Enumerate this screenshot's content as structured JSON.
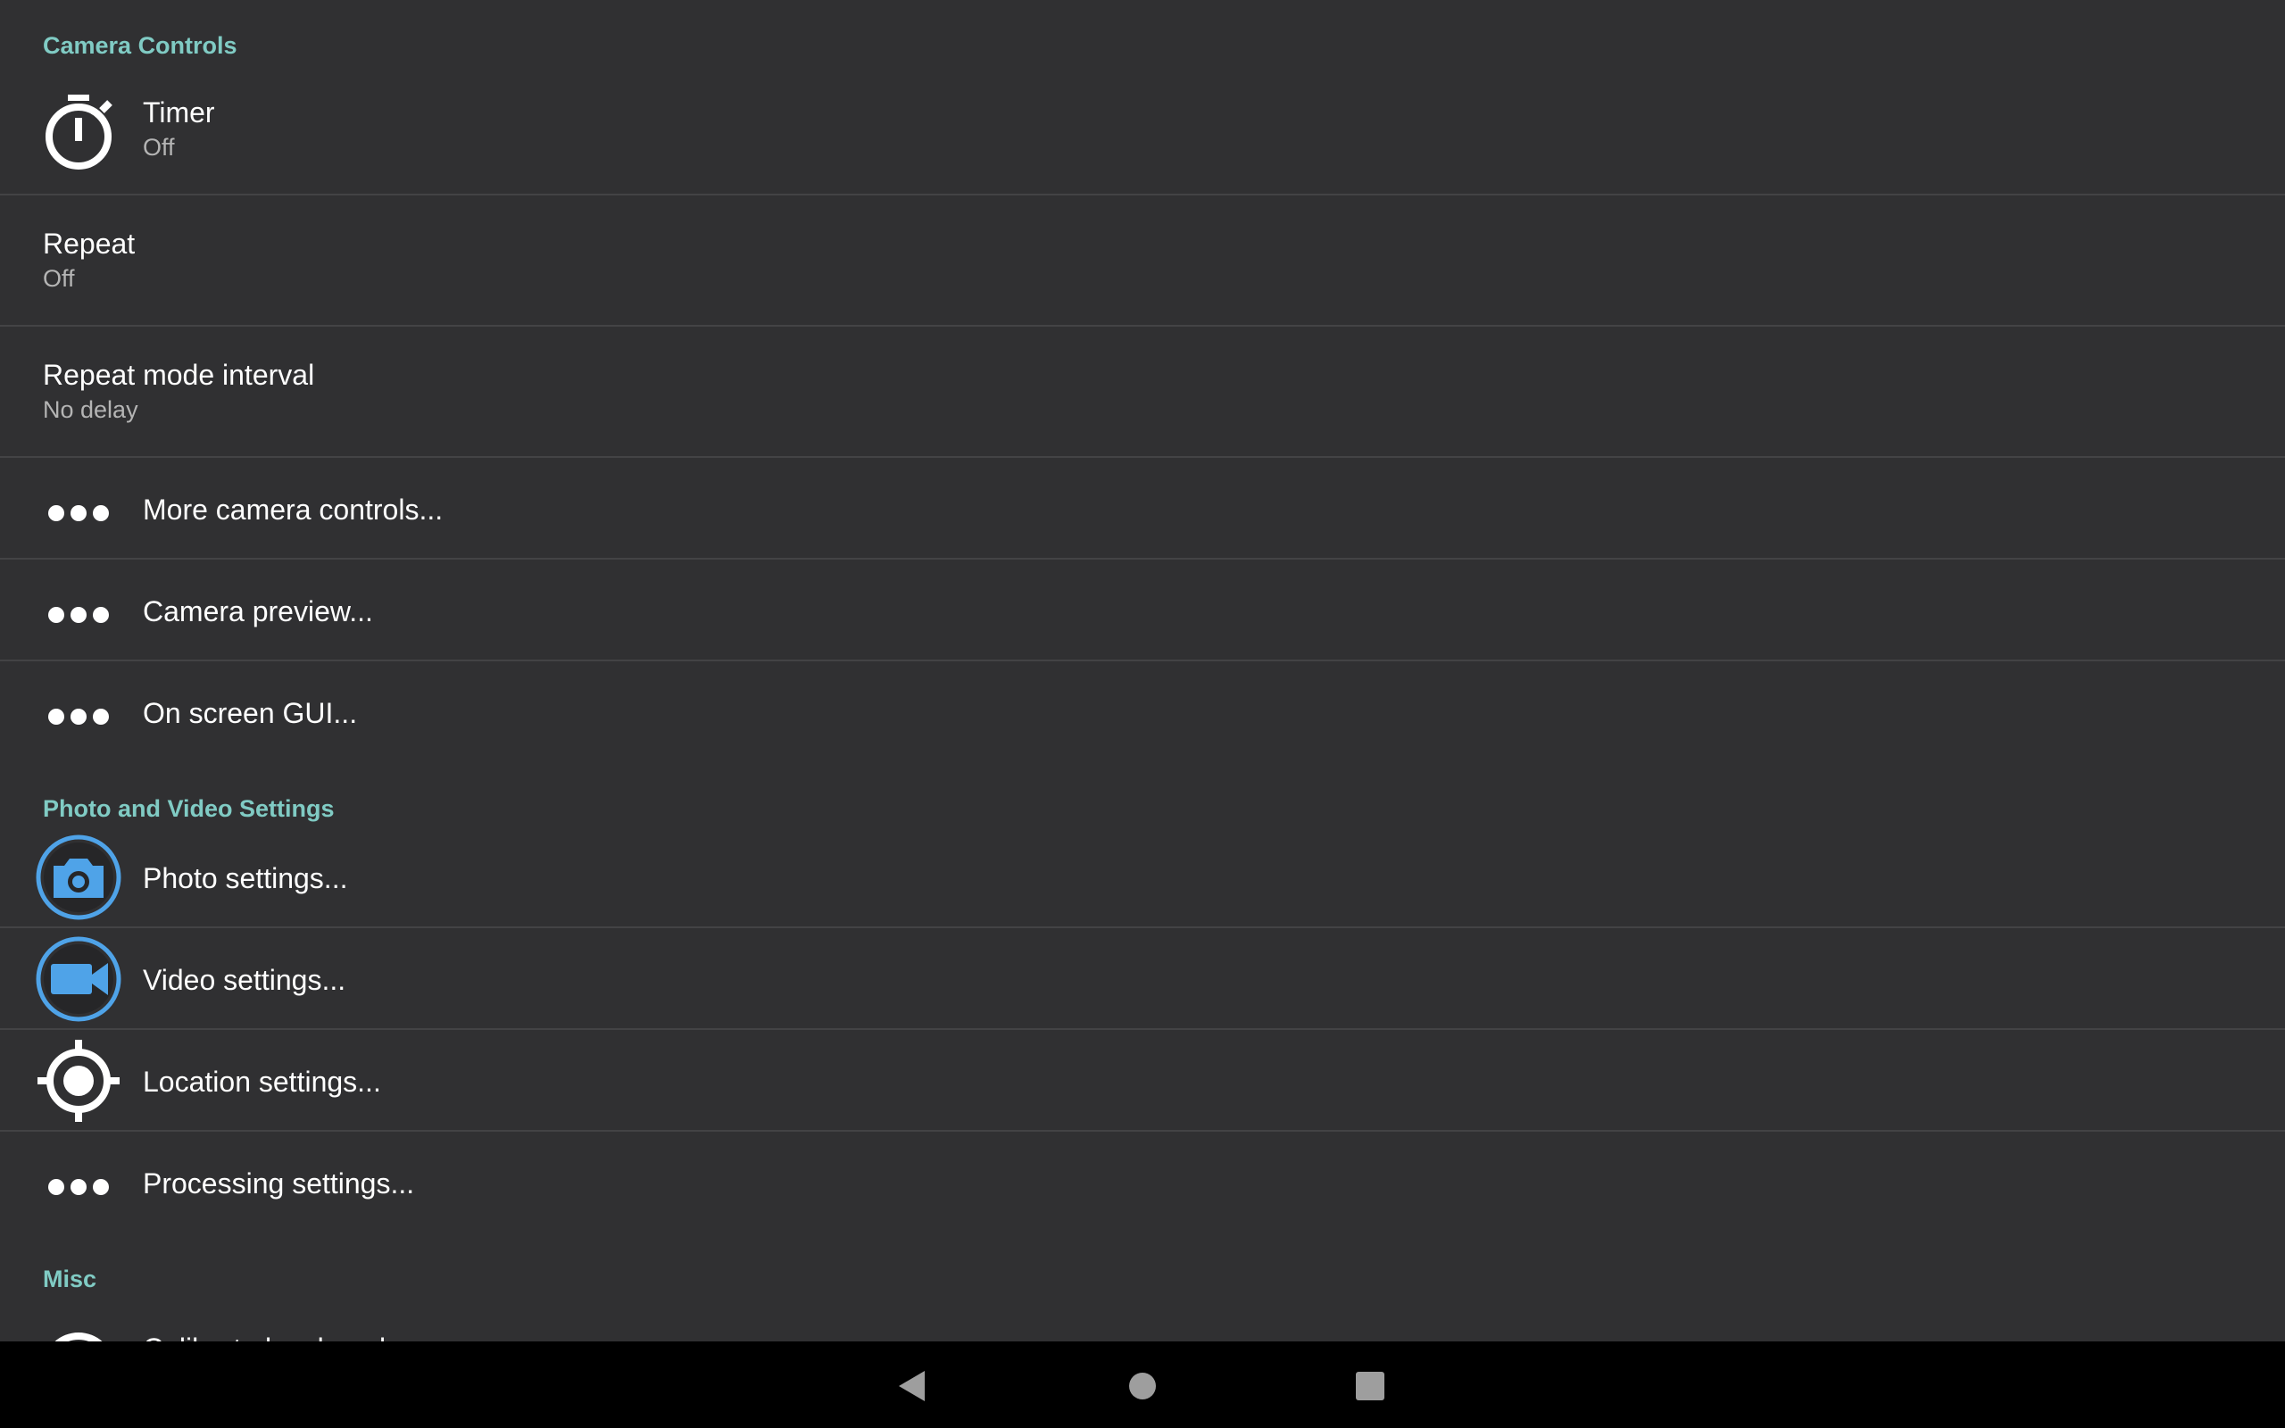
{
  "sections": {
    "camera_controls": "Camera Controls",
    "photo_video": "Photo and Video Settings",
    "misc": "Misc"
  },
  "items": {
    "timer": {
      "title": "Timer",
      "summary": "Off"
    },
    "repeat": {
      "title": "Repeat",
      "summary": "Off"
    },
    "repeat_interval": {
      "title": "Repeat mode interval",
      "summary": "No delay"
    },
    "more_controls": {
      "title": "More camera controls..."
    },
    "camera_preview": {
      "title": "Camera preview..."
    },
    "on_screen_gui": {
      "title": "On screen GUI..."
    },
    "photo_settings": {
      "title": "Photo settings..."
    },
    "video_settings": {
      "title": "Video settings..."
    },
    "location_settings": {
      "title": "Location settings..."
    },
    "processing_settings": {
      "title": "Processing settings..."
    },
    "calibrate": {
      "title": "Calibrate level angles..."
    }
  },
  "colors": {
    "background": "#303032",
    "accent": "#80cbc4",
    "icon_blue": "#4fa3e8",
    "divider": "#434345",
    "navbar": "#000000"
  },
  "icons": {
    "timer": "stopwatch-icon",
    "more": "more-horiz-icon",
    "photo": "camera-icon",
    "video": "videocam-icon",
    "location": "gps-fixed-icon",
    "nav_back": "back-triangle-icon",
    "nav_home": "home-circle-icon",
    "nav_recents": "recents-square-icon"
  }
}
